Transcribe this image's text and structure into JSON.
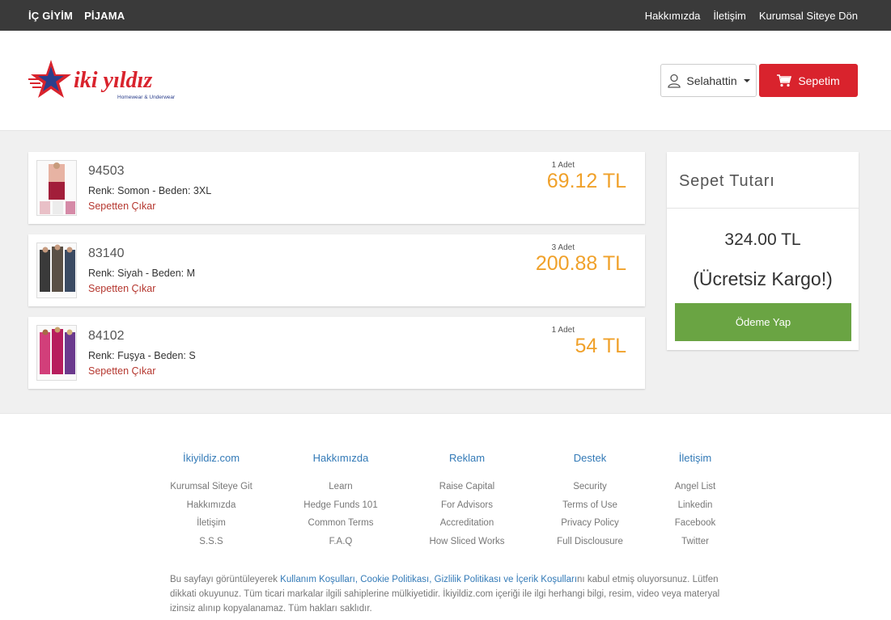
{
  "topbar": {
    "left": [
      "İÇ GİYİM",
      "PİJAMA"
    ],
    "right": [
      "Hakkımızda",
      "İletişim",
      "Kurumsal Siteye Dön"
    ]
  },
  "header": {
    "logo_text": "iki yıldız",
    "logo_tagline": "Homewear & Underwear",
    "user_label": "Selahattin",
    "cart_label": "Sepetim",
    "brand_color": "#d9232d"
  },
  "cart": {
    "items": [
      {
        "code": "94503",
        "attrs": "Renk: Somon - Beden: 3XL",
        "remove": "Sepetten Çıkar",
        "qty": "1 Adet",
        "price": "69.12 TL"
      },
      {
        "code": "83140",
        "attrs": "Renk: Siyah - Beden: M",
        "remove": "Sepetten Çıkar",
        "qty": "3 Adet",
        "price": "200.88 TL"
      },
      {
        "code": "84102",
        "attrs": "Renk: Fuşya - Beden: S",
        "remove": "Sepetten Çıkar",
        "qty": "1 Adet",
        "price": "54 TL"
      }
    ]
  },
  "summary": {
    "title": "Sepet Tutarı",
    "total": "324.00 TL",
    "shipping": "(Ücretsiz Kargo!)",
    "pay_label": "Ödeme Yap"
  },
  "footer": {
    "columns": [
      {
        "head": "İkiyildiz.com",
        "links": [
          "Kurumsal Siteye Git",
          "Hakkımızda",
          "İletişim",
          "S.S.S"
        ]
      },
      {
        "head": "Hakkımızda",
        "links": [
          "Learn",
          "Hedge Funds 101",
          "Common Terms",
          "F.A.Q"
        ]
      },
      {
        "head": "Reklam",
        "links": [
          "Raise Capital",
          "For Advisors",
          "Accreditation",
          "How Sliced Works"
        ]
      },
      {
        "head": "Destek",
        "links": [
          "Security",
          "Terms of Use",
          "Privacy Policy",
          "Full Disclousure"
        ]
      },
      {
        "head": "İletişim",
        "links": [
          "Angel List",
          "Linkedin",
          "Facebook",
          "Twitter"
        ]
      }
    ],
    "legal_before": "Bu sayfayı görüntüleyerek ",
    "legal_link": "Kullanım Koşulları, Cookie Politikası, Gizlilik Politikası ve İçerik Koşulları",
    "legal_after": "nı kabul etmiş oluyorsunuz. Lütfen dikkati okuyunuz. Tüm ticari markalar ilgili sahiplerine mülkiyetidir. İkiyildiz.com içeriği ile ilgi herhangi bilgi, resim, video veya materyal izinsiz alınıp kopyalanamaz. Tüm hakları saklıdır."
  }
}
